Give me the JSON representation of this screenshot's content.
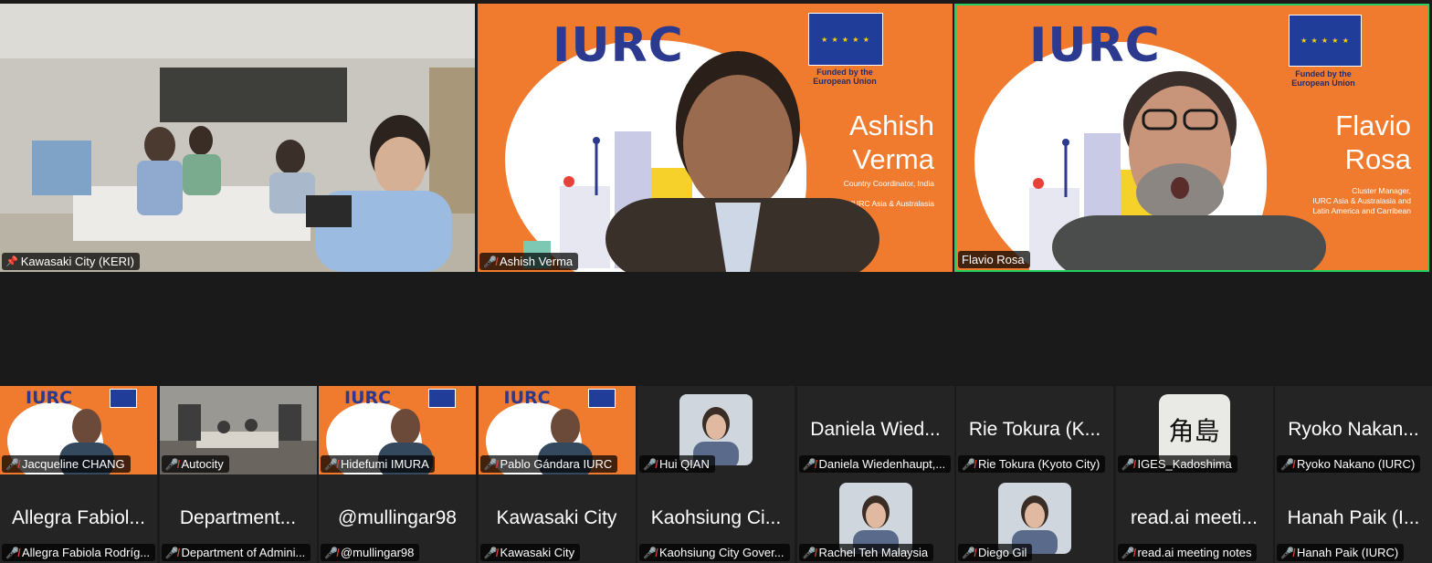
{
  "featured": [
    {
      "name": "Kawasaki City (KERI)",
      "icon": "pin-icon"
    },
    {
      "name": "Ashish Verma",
      "icon": "mic-muted-icon",
      "slide_first": "Ashish",
      "slide_last": "Verma",
      "role": "Country Coordinator, India\n\nIURC Asia & Australasia"
    },
    {
      "name": "Flavio Rosa",
      "icon": "none",
      "slide_first": "Flavio",
      "slide_last": "Rosa",
      "role": "Cluster Manager,\nIURC Asia & Australasia and\nLatin America and Carribean"
    }
  ],
  "branding": {
    "logo": "IURC",
    "funded": "Funded by the\nEuropean Union",
    "eu_flag_color": "#1f3d99",
    "orange": "#f07b2f"
  },
  "row1": [
    {
      "label": "Jacqueline CHANG",
      "big": "",
      "video": "iurc"
    },
    {
      "label": "Autocity",
      "big": "",
      "video": "room"
    },
    {
      "label": "Hidefumi IMURA",
      "big": "",
      "video": "iurc"
    },
    {
      "label": "Pablo Gándara IURC",
      "big": "",
      "video": "iurc"
    },
    {
      "label": "Hui QIAN",
      "big": "",
      "video": "avatar"
    },
    {
      "label": "Daniela Wiedenhaupt,...",
      "big": "Daniela Wied...",
      "video": "none"
    },
    {
      "label": "Rie Tokura (Kyoto City)",
      "big": "Rie Tokura (K...",
      "video": "none"
    },
    {
      "label": "IGES_Kadoshima",
      "big": "",
      "video": "kanji",
      "kanji": "角島"
    },
    {
      "label": "Ryoko Nakano (IURC)",
      "big": "Ryoko Nakan...",
      "video": "none"
    }
  ],
  "row2": [
    {
      "label": "Allegra Fabiola Rodríg...",
      "big": "Allegra Fabiol...",
      "video": "none"
    },
    {
      "label": "Department of Admini...",
      "big": "Department...",
      "video": "none"
    },
    {
      "label": "@mullingar98",
      "big": "@mullingar98",
      "video": "none"
    },
    {
      "label": "Kawasaki City",
      "big": "Kawasaki City",
      "video": "none"
    },
    {
      "label": "Kaohsiung City Gover...",
      "big": "Kaohsiung Ci...",
      "video": "none"
    },
    {
      "label": "Rachel Teh Malaysia",
      "big": "",
      "video": "avatar"
    },
    {
      "label": "Diego Gil",
      "big": "",
      "video": "avatar"
    },
    {
      "label": "read.ai meeting notes",
      "big": "read.ai meeti...",
      "video": "none"
    },
    {
      "label": "Hanah Paik (IURC)",
      "big": "Hanah Paik (I...",
      "video": "none"
    }
  ]
}
